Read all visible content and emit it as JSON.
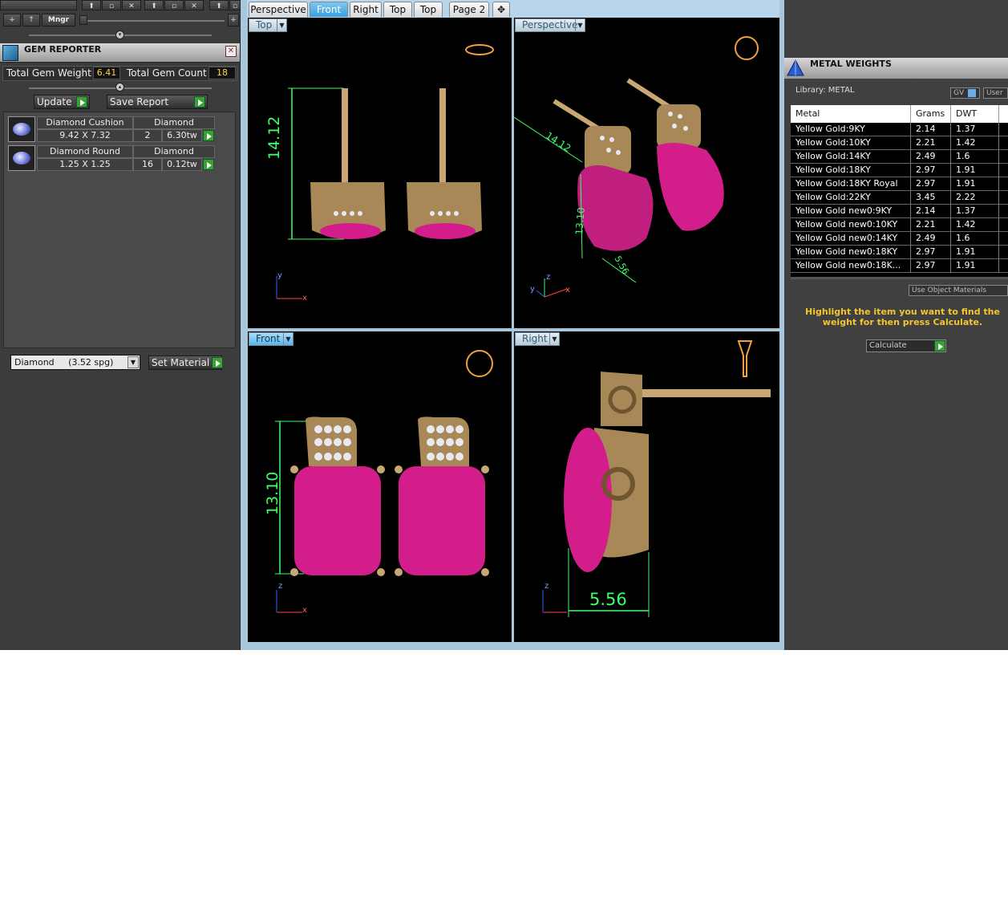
{
  "left_toolbar": {
    "mngr_label": "Mngr"
  },
  "gem_reporter": {
    "title": "GEM REPORTER",
    "total_weight_label": "Total Gem Weight",
    "total_weight_value": "6.41",
    "total_count_label": "Total Gem Count",
    "total_count_value": "18",
    "update_label": "Update",
    "save_report_label": "Save Report",
    "gems": [
      {
        "name": "Diamond Cushion",
        "material": "Diamond",
        "size": "9.42 X 7.32",
        "count": "2",
        "weight": "6.30tw"
      },
      {
        "name": "Diamond Round",
        "material": "Diamond",
        "size": "1.25 X 1.25",
        "count": "16",
        "weight": "0.12tw"
      }
    ],
    "material_select": "Diamond     (3.52 spg)",
    "set_material_label": "Set Material"
  },
  "tabs": [
    "Perspective",
    "Front",
    "Right",
    "Top",
    "Top",
    "Page 2"
  ],
  "active_tab": "Front",
  "viewports": {
    "top_left": {
      "label": "Top",
      "dimension": "14.12"
    },
    "top_right": {
      "label": "Perspective",
      "dimension_a": "14.12",
      "dimension_b": "13.10",
      "dimension_c": "5.56"
    },
    "bottom_left": {
      "label": "Front",
      "dimension": "13.10"
    },
    "bottom_right": {
      "label": "Right",
      "dimension": "5.56"
    }
  },
  "axes": {
    "x": "x",
    "y": "y",
    "z": "z"
  },
  "metal_weights": {
    "title": "METAL WEIGHTS",
    "library": "Library: METAL",
    "gv_label": "GV",
    "user_label": "User",
    "columns": [
      "Metal",
      "Grams",
      "DWT"
    ],
    "rows": [
      [
        "Yellow Gold:9KY",
        "2.14",
        "1.37"
      ],
      [
        "Yellow Gold:10KY",
        "2.21",
        "1.42"
      ],
      [
        "Yellow Gold:14KY",
        "2.49",
        "1.6"
      ],
      [
        "Yellow Gold:18KY",
        "2.97",
        "1.91"
      ],
      [
        "Yellow Gold:18KY Royal",
        "2.97",
        "1.91"
      ],
      [
        "Yellow Gold:22KY",
        "3.45",
        "2.22"
      ],
      [
        "Yellow Gold new0:9KY",
        "2.14",
        "1.37"
      ],
      [
        "Yellow Gold new0:10KY",
        "2.21",
        "1.42"
      ],
      [
        "Yellow Gold new0:14KY",
        "2.49",
        "1.6"
      ],
      [
        "Yellow Gold new0:18KY",
        "2.97",
        "1.91"
      ],
      [
        "Yellow Gold new0:18K...",
        "2.97",
        "1.91"
      ]
    ],
    "use_object_materials": "Use Object Materials",
    "hint": "Highlight the item you want to find the weight for then press Calculate.",
    "calculate_label": "Calculate"
  },
  "colors": {
    "accent": "#3a9fe0",
    "hint": "#f2c531",
    "dim_green": "#3cff6a",
    "gold": "#c9a774",
    "ruby": "#d21d8a"
  }
}
